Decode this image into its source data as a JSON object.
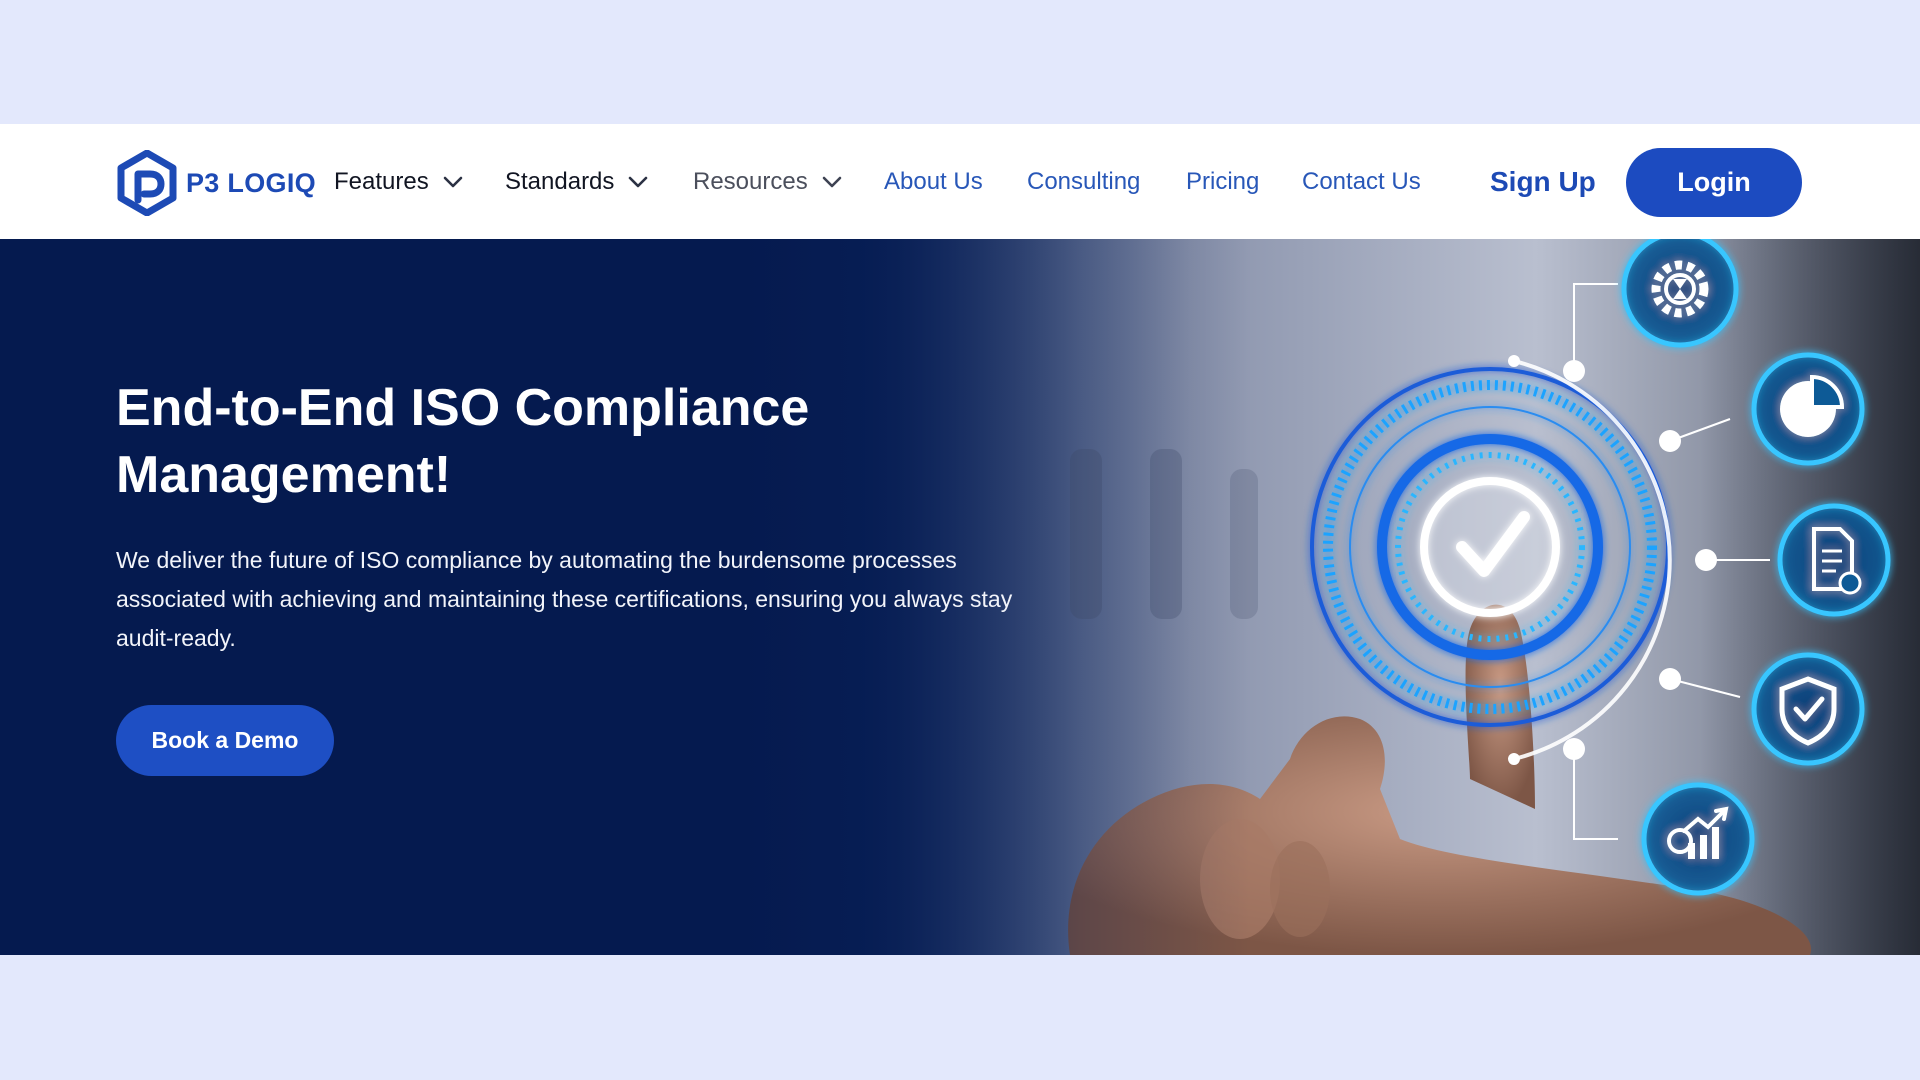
{
  "brand": {
    "name": "P3 LOGIQ",
    "icon": "p3-logiq-hexagon-logo"
  },
  "nav": {
    "items": [
      {
        "label": "Features",
        "has_dropdown": true
      },
      {
        "label": "Standards",
        "has_dropdown": true
      },
      {
        "label": "Resources",
        "has_dropdown": true
      },
      {
        "label": "About Us",
        "has_dropdown": false
      },
      {
        "label": "Consulting",
        "has_dropdown": false
      },
      {
        "label": "Pricing",
        "has_dropdown": false
      },
      {
        "label": "Contact Us",
        "has_dropdown": false
      }
    ],
    "signup_label": "Sign Up",
    "login_label": "Login"
  },
  "hero": {
    "title_line1": "End-to-End ISO Compliance",
    "title_line2": "Management!",
    "description": "We deliver the future of ISO compliance by automating the burdensome processes associated with achieving and maintaining these certifications, ensuring you always stay audit-ready.",
    "cta_label": "Book a Demo",
    "icons": [
      "checkmark-icon",
      "gear-hourglass-icon",
      "pie-chart-icon",
      "document-check-icon",
      "shield-check-icon",
      "growth-chart-icon"
    ]
  },
  "colors": {
    "page_background": "#e3e8fc",
    "navbar_background": "#ffffff",
    "brand_blue": "#1d4ab5",
    "button_blue": "#1c4bc0",
    "hero_navy": "#051a4f",
    "glow_cyan": "#39c6ff"
  }
}
